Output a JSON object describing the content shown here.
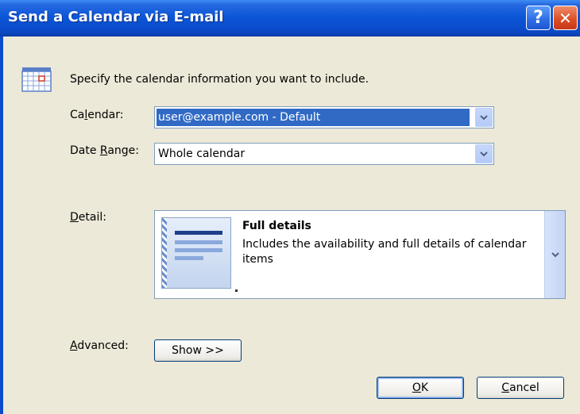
{
  "window": {
    "title": "Send a Calendar via E-mail",
    "help_glyph": "?",
    "close_glyph": "✕"
  },
  "intro": {
    "icon": "calendar-icon",
    "text": "Specify the calendar information you want to include."
  },
  "calendar": {
    "label_pre": "Ca",
    "label_key": "l",
    "label_post": "endar:",
    "value": "user@example.com - Default"
  },
  "date_range": {
    "label_pre": "Date ",
    "label_key": "R",
    "label_post": "ange:",
    "value": "Whole calendar"
  },
  "detail": {
    "label_key": "D",
    "label_post": "etail:",
    "option_title": "Full details",
    "option_description": "Includes the availability and full details of calendar items"
  },
  "advanced": {
    "label_key": "A",
    "label_post": "dvanced:",
    "show_button": "Show >>"
  },
  "buttons": {
    "ok_key": "O",
    "ok_post": "K",
    "cancel_key": "C",
    "cancel_post": "ancel"
  },
  "colors": {
    "titlebar": "#0a55d6",
    "dialog_bg": "#ece9d8",
    "selection": "#316ac5"
  }
}
